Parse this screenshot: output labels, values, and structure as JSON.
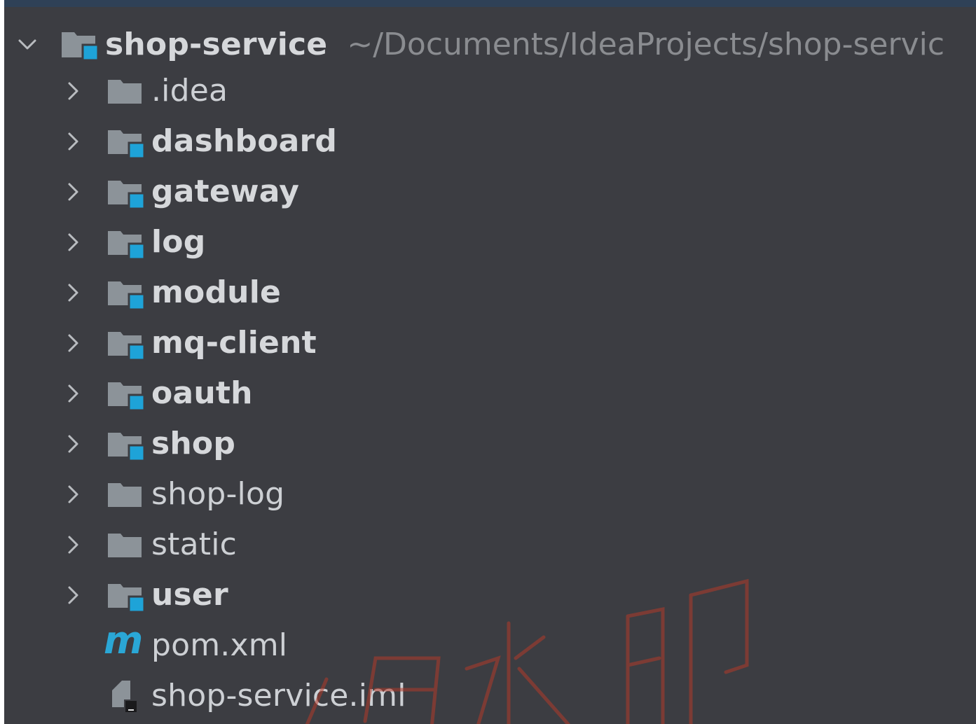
{
  "project": {
    "name": "shop-service",
    "path": "~/Documents/IdeaProjects/shop-servic"
  },
  "items": [
    {
      "label": ".idea",
      "kind": "folder",
      "bold": false
    },
    {
      "label": "dashboard",
      "kind": "module",
      "bold": true
    },
    {
      "label": "gateway",
      "kind": "module",
      "bold": true
    },
    {
      "label": "log",
      "kind": "module",
      "bold": true
    },
    {
      "label": "module",
      "kind": "module",
      "bold": true
    },
    {
      "label": "mq-client",
      "kind": "module",
      "bold": true
    },
    {
      "label": "oauth",
      "kind": "module",
      "bold": true
    },
    {
      "label": "shop",
      "kind": "module",
      "bold": true
    },
    {
      "label": "shop-log",
      "kind": "folder",
      "bold": false
    },
    {
      "label": "static",
      "kind": "folder",
      "bold": false
    },
    {
      "label": "user",
      "kind": "module",
      "bold": true
    },
    {
      "label": "pom.xml",
      "kind": "maven-file",
      "bold": false
    },
    {
      "label": "shop-service.iml",
      "kind": "iml-file",
      "bold": false
    }
  ],
  "icons": {
    "expanded": "chevron-down-icon",
    "collapsed": "chevron-right-icon",
    "folder": "folder-icon",
    "module": "module-folder-icon",
    "maven": "maven-icon",
    "iml": "iml-file-icon",
    "maven_glyph": "m"
  },
  "colors": {
    "panel_bg": "#3c3d42",
    "top_strip": "#2f4157",
    "folder_gray": "#8c9399",
    "module_badge": "#1ea3d8",
    "text": "#cdd0d4",
    "path_text": "#8a8c90",
    "watermark": "#b23a2a"
  }
}
